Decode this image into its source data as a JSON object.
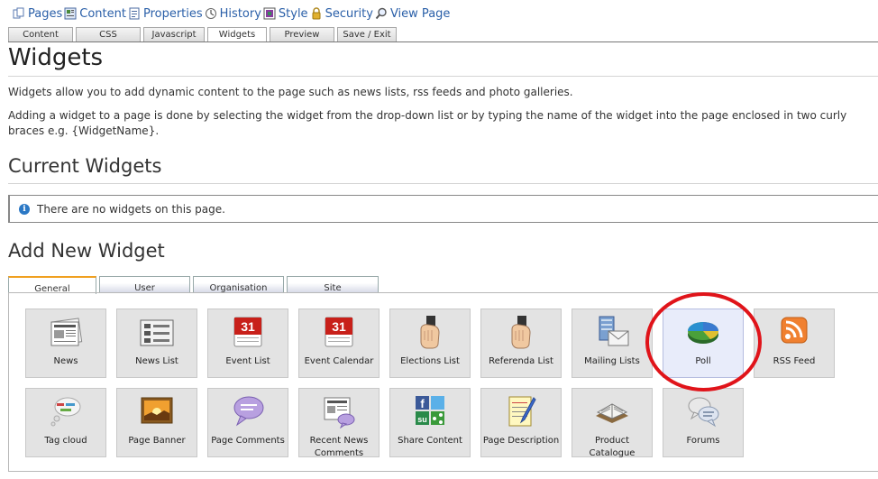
{
  "toolbar": {
    "items": [
      {
        "label": "Pages",
        "icon": "pages-icon"
      },
      {
        "label": "Content",
        "icon": "content-icon"
      },
      {
        "label": "Properties",
        "icon": "properties-icon"
      },
      {
        "label": "History",
        "icon": "history-icon"
      },
      {
        "label": "Style",
        "icon": "style-icon"
      },
      {
        "label": "Security",
        "icon": "lock-icon"
      },
      {
        "label": "View Page",
        "icon": "magnifier-icon"
      }
    ]
  },
  "tabs": [
    "Content",
    "CSS",
    "Javascript",
    "Widgets",
    "Preview",
    "Save / Exit"
  ],
  "active_tab": "Widgets",
  "page": {
    "title": "Widgets",
    "intro": "Widgets allow you to add dynamic content to the page such as news lists, rss feeds and photo galleries.",
    "instructions": "Adding a widget to a page is done by selecting the widget from the drop-down list or by typing the name of the widget into the page enclosed in two curly braces e.g. {WidgetName}."
  },
  "current_widgets": {
    "heading": "Current Widgets",
    "empty_message": "There are no widgets on this page."
  },
  "add_widget": {
    "heading": "Add New Widget",
    "tabs": [
      "General",
      "User",
      "Organisation",
      "Site"
    ],
    "active_tab": "General",
    "widgets": [
      {
        "label": "News",
        "icon": "newspaper-icon"
      },
      {
        "label": "News List",
        "icon": "news-list-icon"
      },
      {
        "label": "Event List",
        "icon": "calendar-icon"
      },
      {
        "label": "Event Calendar",
        "icon": "calendar-icon"
      },
      {
        "label": "Elections List",
        "icon": "hand-ballot-icon"
      },
      {
        "label": "Referenda List",
        "icon": "hand-ballot-icon"
      },
      {
        "label": "Mailing Lists",
        "icon": "mailing-list-icon"
      },
      {
        "label": "Poll",
        "icon": "pie-chart-icon",
        "selected": true
      },
      {
        "label": "RSS Feed",
        "icon": "rss-icon"
      },
      {
        "label": "Tag cloud",
        "icon": "tag-cloud-icon"
      },
      {
        "label": "Page Banner",
        "icon": "banner-icon"
      },
      {
        "label": "Page Comments",
        "icon": "speech-bubble-icon"
      },
      {
        "label": "Recent News Comments",
        "icon": "newspaper-comment-icon"
      },
      {
        "label": "Share Content",
        "icon": "share-icon"
      },
      {
        "label": "Page Description",
        "icon": "notepad-icon"
      },
      {
        "label": "Product Catalogue",
        "icon": "open-book-icon"
      },
      {
        "label": "Forums",
        "icon": "forum-bubbles-icon"
      }
    ]
  },
  "colors": {
    "link": "#2a5fa8",
    "highlight_circle": "#e0141a",
    "tile_bg": "#e3e3e3",
    "info_icon": "#2b78c5"
  }
}
